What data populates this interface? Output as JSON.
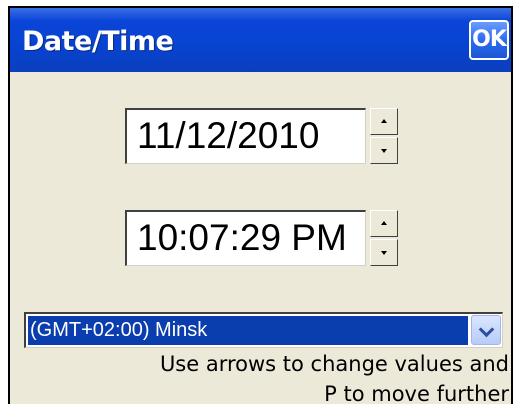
{
  "window": {
    "title": "Date/Time",
    "ok_label": "OK"
  },
  "date": {
    "value": "11/12/2010"
  },
  "time": {
    "value": "10:07:29 PM"
  },
  "timezone": {
    "selected": "(GMT+02:00) Minsk"
  },
  "hint": {
    "line1": "Use arrows to change values and",
    "line2": "P to move further"
  },
  "colors": {
    "titlebar": "#0843d0",
    "background": "#ece9d8",
    "selection": "#0a3dad"
  },
  "icons": {
    "spin_up": "triangle-up",
    "spin_down": "triangle-down",
    "dropdown": "chevron-down"
  }
}
